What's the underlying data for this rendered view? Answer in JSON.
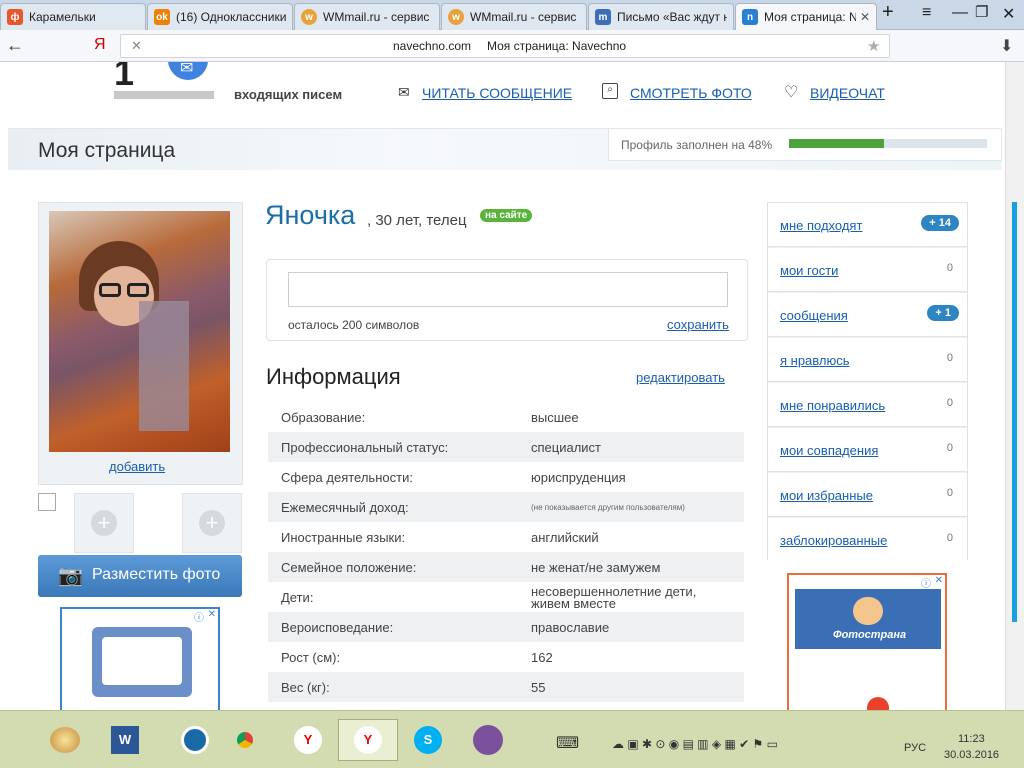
{
  "browser": {
    "tabs": [
      {
        "title": "Карамельки",
        "icon": "ф",
        "color": "#e8572c"
      },
      {
        "title": "(16) Одноклассники",
        "icon": "ok",
        "color": "#ee8208"
      },
      {
        "title": "WMmail.ru - сервис",
        "icon": "w",
        "color": "#e9a23b"
      },
      {
        "title": "WMmail.ru - сервис",
        "icon": "w",
        "color": "#e9a23b"
      },
      {
        "title": "Письмо «Вас ждут н",
        "icon": "m",
        "color": "#3d6fb6"
      },
      {
        "title": "Моя страница: N",
        "icon": "n",
        "color": "#2a7fd1"
      }
    ],
    "url": "navechno.com",
    "page_title": "Моя страница: Navechno",
    "logo_letter": "Я"
  },
  "header": {
    "count": "1",
    "incoming": "входящих писем",
    "read_message": "ЧИТАТЬ СООБЩЕНИЕ",
    "see_photo": "СМОТРЕТЬ ФОТО",
    "videochat": "ВИДЕОЧАТ"
  },
  "page": {
    "title": "Моя страница",
    "progress_label": "Профиль заполнен на 48%",
    "progress": 48
  },
  "profile": {
    "name": "Яночка",
    "details": ", 30 лет, телец",
    "online": "на сайте",
    "add_photo": "добавить",
    "place_photo": "Разместить фото",
    "status_remaining": "осталось 200 символов",
    "save": "сохранить"
  },
  "info": {
    "heading": "Информация",
    "edit": "редактировать",
    "rows": [
      {
        "k": "Образование:",
        "v": "высшее"
      },
      {
        "k": "Профессиональный статус:",
        "v": "специалист"
      },
      {
        "k": "Сфера деятельности:",
        "v": "юриспруденция"
      },
      {
        "k": "Ежемесячный доход:",
        "v": "(не показывается другим пользователям)"
      },
      {
        "k": "Иностранные языки:",
        "v": "английский"
      },
      {
        "k": "Семейное положение:",
        "v": "не женат/не замужем"
      },
      {
        "k": "Дети:",
        "v": "несовершеннолетние дети,",
        "v2": "живем вместе"
      },
      {
        "k": "Вероисповедание:",
        "v": "православие"
      },
      {
        "k": "Рост (см):",
        "v": "162"
      },
      {
        "k": "Вес (кг):",
        "v": "55"
      }
    ]
  },
  "sidebar": {
    "items": [
      {
        "label": "мне подходят",
        "count": "+ 14",
        "badge": true
      },
      {
        "label": "мои гости",
        "count": "0",
        "badge": false
      },
      {
        "label": "сообщения",
        "count": "+ 1",
        "badge": true
      },
      {
        "label": "я нравлюсь",
        "count": "0",
        "badge": false
      },
      {
        "label": "мне понравились",
        "count": "0",
        "badge": false
      },
      {
        "label": "мои совпадения",
        "count": "0",
        "badge": false
      },
      {
        "label": "мои избранные",
        "count": "0",
        "badge": false
      },
      {
        "label": "заблокированные",
        "count": "0",
        "badge": false
      }
    ]
  },
  "ad": {
    "brand": "Фотострана"
  },
  "taskbar": {
    "lang": "РУС",
    "time": "11:23",
    "date": "30.03.2016"
  }
}
